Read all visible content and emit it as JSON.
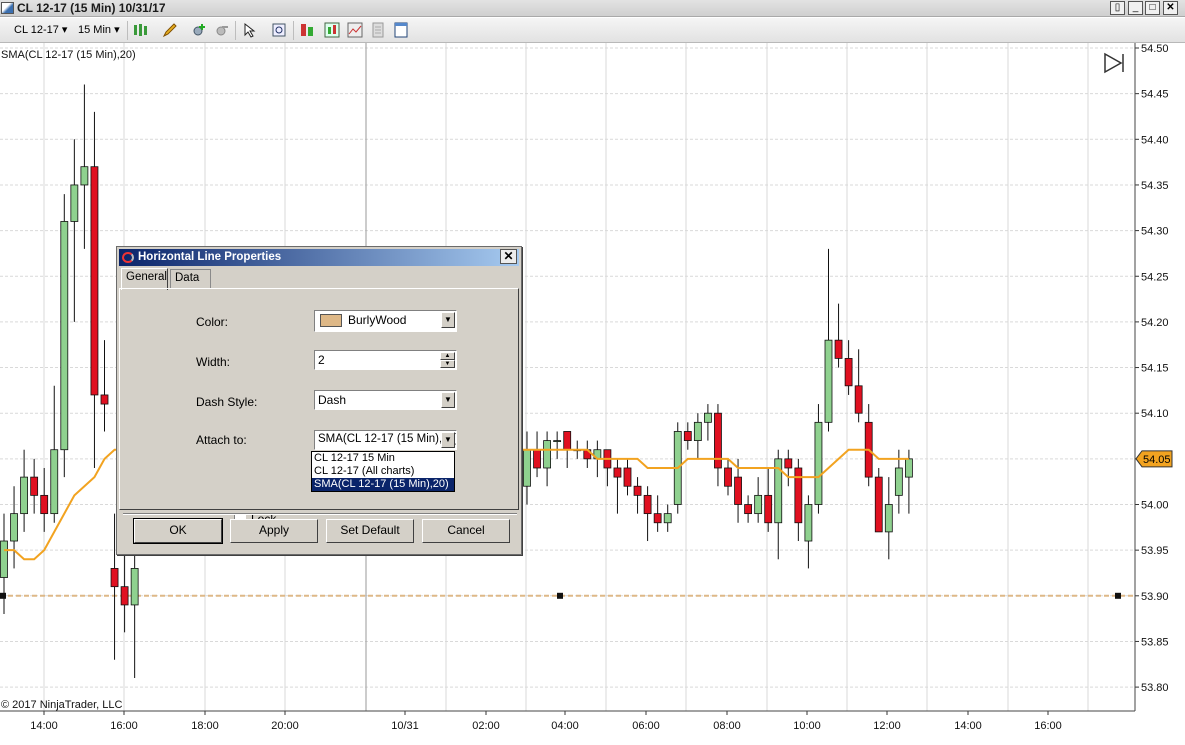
{
  "window": {
    "title": "CL 12-17 (15 Min)  10/31/17",
    "controls": [
      "restore-down",
      "minimize",
      "maximize",
      "close"
    ]
  },
  "toolbar": {
    "instrument": "CL 12-17",
    "interval": "15 Min",
    "icons": [
      "bar-type-icon",
      "drawing-pencil-icon",
      "zoom-in-icon",
      "zoom-out-icon",
      "cursor-icon",
      "magnifier-icon",
      "data-box-icon",
      "indicators-icon",
      "strategies-icon",
      "properties-icon",
      "template-icon"
    ]
  },
  "chart": {
    "indicator_label": "SMA(CL 12-17 (15 Min),20)",
    "copyright": "© 2017 NinjaTrader, LLC",
    "last_price_badge": "54.05"
  },
  "chart_data": {
    "type": "candlestick",
    "instrument": "CL 12-17",
    "interval": "15 Min",
    "y_ticks": [
      "54.50",
      "54.45",
      "54.40",
      "54.35",
      "54.30",
      "54.25",
      "54.20",
      "54.15",
      "54.10",
      "54.05",
      "54.00",
      "53.95",
      "53.90",
      "53.85",
      "53.80"
    ],
    "ylim": [
      53.78,
      54.5
    ],
    "x_ticks": [
      "14:00",
      "16:00",
      "18:00",
      "20:00",
      "10/31",
      "02:00",
      "04:00",
      "06:00",
      "08:00",
      "10:00",
      "12:00",
      "14:00",
      "16:00"
    ],
    "candles": [
      {
        "o": 53.92,
        "h": 53.99,
        "l": 53.88,
        "c": 53.96
      },
      {
        "o": 53.96,
        "h": 54.02,
        "l": 53.93,
        "c": 53.99
      },
      {
        "o": 53.99,
        "h": 54.06,
        "l": 53.97,
        "c": 54.03
      },
      {
        "o": 54.03,
        "h": 54.05,
        "l": 53.99,
        "c": 54.01
      },
      {
        "o": 54.01,
        "h": 54.04,
        "l": 53.97,
        "c": 53.99
      },
      {
        "o": 53.99,
        "h": 54.13,
        "l": 53.98,
        "c": 54.06
      },
      {
        "o": 54.06,
        "h": 54.34,
        "l": 54.03,
        "c": 54.31
      },
      {
        "o": 54.31,
        "h": 54.4,
        "l": 54.2,
        "c": 54.35
      },
      {
        "o": 54.35,
        "h": 54.46,
        "l": 54.28,
        "c": 54.37
      },
      {
        "o": 54.37,
        "h": 54.43,
        "l": 54.04,
        "c": 54.12
      },
      {
        "o": 54.12,
        "h": 54.18,
        "l": 54.08,
        "c": 54.11
      },
      {
        "o": 53.93,
        "h": 53.99,
        "l": 53.83,
        "c": 53.91
      },
      {
        "o": 53.91,
        "h": 53.97,
        "l": 53.86,
        "c": 53.89
      },
      {
        "o": 53.89,
        "h": 53.96,
        "l": 53.81,
        "c": 53.93
      },
      {
        "o": 54.02,
        "h": 54.08,
        "l": 54.0,
        "c": 54.06
      },
      {
        "o": 54.06,
        "h": 54.08,
        "l": 54.03,
        "c": 54.04
      },
      {
        "o": 54.04,
        "h": 54.08,
        "l": 54.02,
        "c": 54.07
      },
      {
        "o": 54.07,
        "h": 54.08,
        "l": 54.05,
        "c": 54.07
      },
      {
        "o": 54.08,
        "h": 54.08,
        "l": 54.04,
        "c": 54.06
      },
      {
        "o": 54.06,
        "h": 54.07,
        "l": 54.05,
        "c": 54.06
      },
      {
        "o": 54.06,
        "h": 54.07,
        "l": 54.04,
        "c": 54.05
      },
      {
        "o": 54.05,
        "h": 54.07,
        "l": 54.03,
        "c": 54.06
      },
      {
        "o": 54.06,
        "h": 54.06,
        "l": 54.02,
        "c": 54.04
      },
      {
        "o": 54.04,
        "h": 54.05,
        "l": 53.99,
        "c": 54.03
      },
      {
        "o": 54.04,
        "h": 54.05,
        "l": 54.01,
        "c": 54.02
      },
      {
        "o": 54.02,
        "h": 54.03,
        "l": 53.99,
        "c": 54.01
      },
      {
        "o": 54.01,
        "h": 54.02,
        "l": 53.96,
        "c": 53.99
      },
      {
        "o": 53.99,
        "h": 54.01,
        "l": 53.97,
        "c": 53.98
      },
      {
        "o": 53.98,
        "h": 54.0,
        "l": 53.97,
        "c": 53.99
      },
      {
        "o": 54.0,
        "h": 54.09,
        "l": 53.99,
        "c": 54.08
      },
      {
        "o": 54.08,
        "h": 54.09,
        "l": 54.06,
        "c": 54.07
      },
      {
        "o": 54.07,
        "h": 54.1,
        "l": 54.05,
        "c": 54.09
      },
      {
        "o": 54.09,
        "h": 54.11,
        "l": 54.07,
        "c": 54.1
      },
      {
        "o": 54.1,
        "h": 54.11,
        "l": 54.02,
        "c": 54.04
      },
      {
        "o": 54.04,
        "h": 54.05,
        "l": 54.01,
        "c": 54.02
      },
      {
        "o": 54.03,
        "h": 54.05,
        "l": 53.98,
        "c": 54.0
      },
      {
        "o": 54.0,
        "h": 54.01,
        "l": 53.98,
        "c": 53.99
      },
      {
        "o": 53.99,
        "h": 54.03,
        "l": 53.98,
        "c": 54.01
      },
      {
        "o": 54.01,
        "h": 54.04,
        "l": 53.97,
        "c": 53.98
      },
      {
        "o": 53.98,
        "h": 54.06,
        "l": 53.94,
        "c": 54.05
      },
      {
        "o": 54.05,
        "h": 54.06,
        "l": 54.02,
        "c": 54.04
      },
      {
        "o": 54.04,
        "h": 54.05,
        "l": 53.96,
        "c": 53.98
      },
      {
        "o": 53.96,
        "h": 54.01,
        "l": 53.93,
        "c": 54.0
      },
      {
        "o": 54.0,
        "h": 54.11,
        "l": 53.99,
        "c": 54.09
      },
      {
        "o": 54.09,
        "h": 54.28,
        "l": 54.08,
        "c": 54.18
      },
      {
        "o": 54.18,
        "h": 54.22,
        "l": 54.15,
        "c": 54.16
      },
      {
        "o": 54.16,
        "h": 54.18,
        "l": 54.12,
        "c": 54.13
      },
      {
        "o": 54.13,
        "h": 54.17,
        "l": 54.09,
        "c": 54.1
      },
      {
        "o": 54.09,
        "h": 54.11,
        "l": 54.02,
        "c": 54.03
      },
      {
        "o": 54.03,
        "h": 54.04,
        "l": 53.97,
        "c": 53.97
      },
      {
        "o": 53.97,
        "h": 54.03,
        "l": 53.94,
        "c": 54.0
      },
      {
        "o": 54.01,
        "h": 54.06,
        "l": 53.99,
        "c": 54.04
      },
      {
        "o": 54.03,
        "h": 54.06,
        "l": 53.99,
        "c": 54.05
      }
    ],
    "sma": {
      "name": "SMA(CL 12-17 (15 Min),20)",
      "color": "#f2a320",
      "values": [
        53.95,
        53.95,
        53.94,
        53.94,
        53.95,
        53.97,
        53.99,
        54.01,
        54.02,
        54.03,
        54.05,
        54.06,
        54.06,
        54.06,
        54.06,
        54.06,
        54.06,
        54.06,
        54.06,
        54.06,
        54.06,
        54.05,
        54.05,
        54.05,
        54.05,
        54.05,
        54.04,
        54.04,
        54.04,
        54.04,
        54.05,
        54.05,
        54.05,
        54.05,
        54.05,
        54.04,
        54.04,
        54.04,
        54.04,
        54.04,
        54.03,
        54.03,
        54.03,
        54.03,
        54.04,
        54.05,
        54.06,
        54.06,
        54.06,
        54.05,
        54.05,
        54.05,
        54.05
      ]
    },
    "horizontal_line": {
      "value": 53.9,
      "color": "#deb887",
      "style": "dash"
    },
    "up_color": "#8fd18f",
    "down_color": "#e01020",
    "grid": true
  },
  "dialog": {
    "title": "Horizontal Line Properties",
    "tabs": [
      "General",
      "Data"
    ],
    "active_tab": "General",
    "color_label": "Color:",
    "color_value": "BurlyWood",
    "width_label": "Width:",
    "width_value": "2",
    "dash_label": "Dash Style:",
    "dash_value": "Dash",
    "attach_label": "Attach to:",
    "attach_value": "SMA(CL 12-17 (15 Min),20)",
    "attach_options": [
      "CL 12-17 15 Min",
      "CL 12-17 (All charts)",
      "SMA(CL 12-17 (15 Min),20)"
    ],
    "lock_label": "Lock",
    "buttons": {
      "ok": "OK",
      "apply": "Apply",
      "set_default": "Set Default",
      "cancel": "Cancel"
    }
  }
}
